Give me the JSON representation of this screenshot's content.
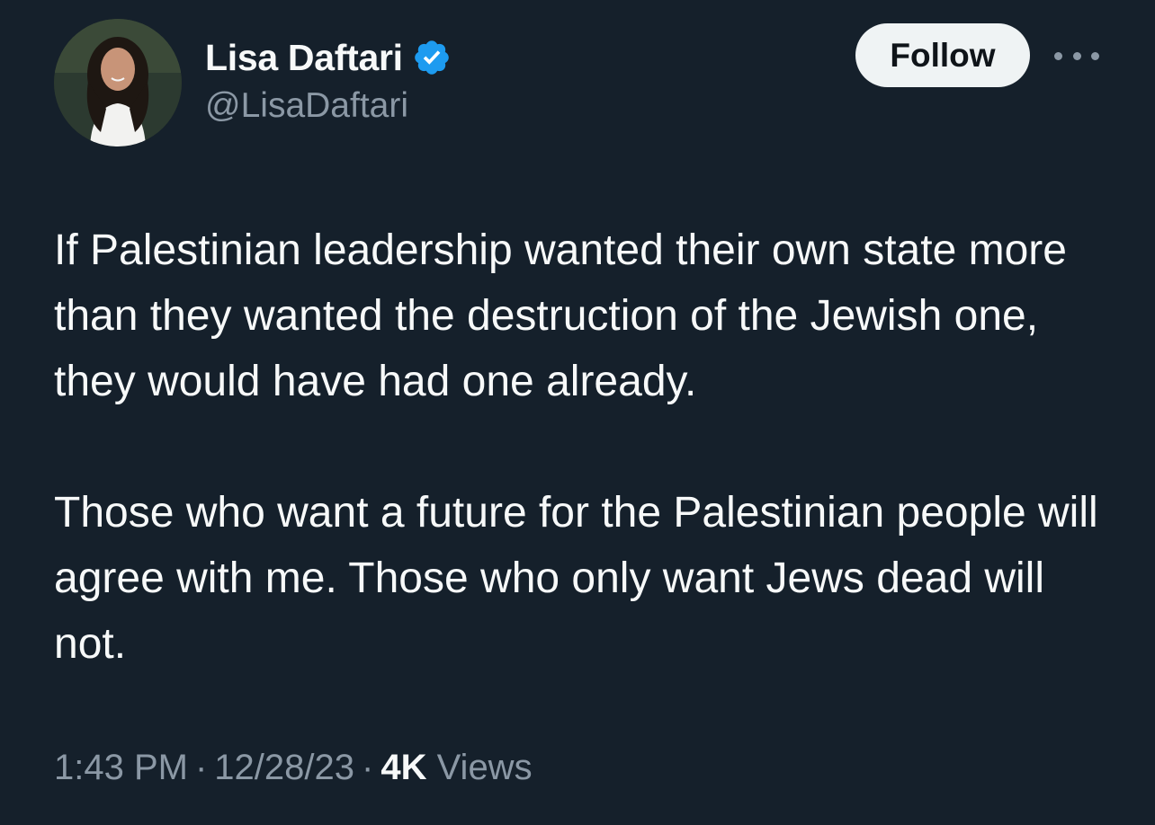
{
  "author": {
    "display_name": "Lisa Daftari",
    "handle": "@LisaDaftari",
    "verified": true,
    "verified_color": "#1d9bf0"
  },
  "actions": {
    "follow_label": "Follow"
  },
  "tweet": {
    "text": "If Palestinian leadership wanted their own state more than they wanted the destruction of the Jewish one, they would have had one already.\n\nThose who want a future for the Palestinian people will agree with me. Those who only want Jews dead will not."
  },
  "meta": {
    "time": "1:43 PM",
    "date": "12/28/23",
    "views_count": "4K",
    "views_label": "Views",
    "separator": "·"
  },
  "colors": {
    "background": "#15202b",
    "text": "#f7f9f9",
    "secondary": "#8b98a5",
    "follow_bg": "#eff3f4"
  }
}
